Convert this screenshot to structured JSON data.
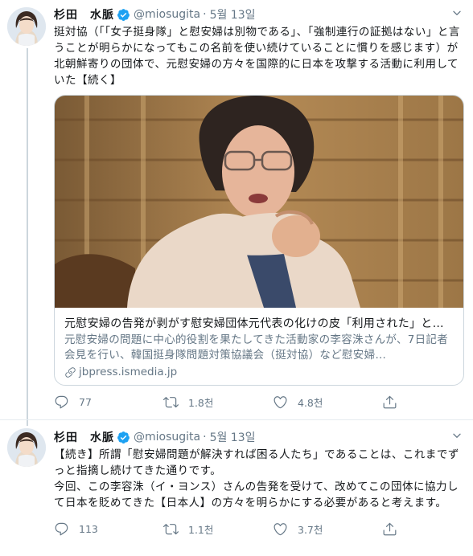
{
  "tweets": [
    {
      "display_name": "杉田　水脈",
      "handle": "@miosugita",
      "separator": "·",
      "date": "5월 13일",
      "text_lines": [
        "挺対協（「「女子挺身隊」と慰安婦は別物である」、「強制連行の証拠はない」と言うことが明らかになってもこの名前を使い続けていることに慣りを感じます）が北朝鮮寄りの団体で、元慰安婦の方々を国際的に日本を攻撃する活動に利用していた【続く】"
      ],
      "card": {
        "title": "元慰安婦の告発が剥がす慰安婦団体元代表の化けの皮「利用された」と…",
        "description": "元慰安婦の問題に中心的役割を果たしてきた活動家の李容洙さんが、7日記者会見を行い、韓国挺身隊問題対策協議会（挺対協）など慰安婦…",
        "link": "jbpress.ismedia.jp"
      },
      "actions": {
        "replies": "77",
        "retweets": "1.8천",
        "likes": "4.8천"
      }
    },
    {
      "display_name": "杉田　水脈",
      "handle": "@miosugita",
      "separator": "·",
      "date": "5월 13일",
      "text_lines": [
        "【続き】所謂「慰安婦問題が解決すれば困る人たち」であることは、これまでずっと指摘し続けてきた通りです。",
        "今回、この李容洙（イ・ヨンス）さんの告発を受けて、改めてこの団体に協力して日本を貶めてきた【日本人】の方々を明らかにする必要があると考えます。"
      ],
      "actions": {
        "replies": "113",
        "retweets": "1.1천",
        "likes": "3.7천"
      }
    }
  ],
  "icons": {
    "verified": "verified-badge-icon",
    "more": "chevron-down-icon",
    "reply": "reply-icon",
    "retweet": "retweet-icon",
    "like": "heart-icon",
    "share": "share-icon",
    "link": "link-icon"
  },
  "colors": {
    "accent": "#1da1f2",
    "secondary_text": "#657786",
    "border": "#ccd6dd"
  }
}
